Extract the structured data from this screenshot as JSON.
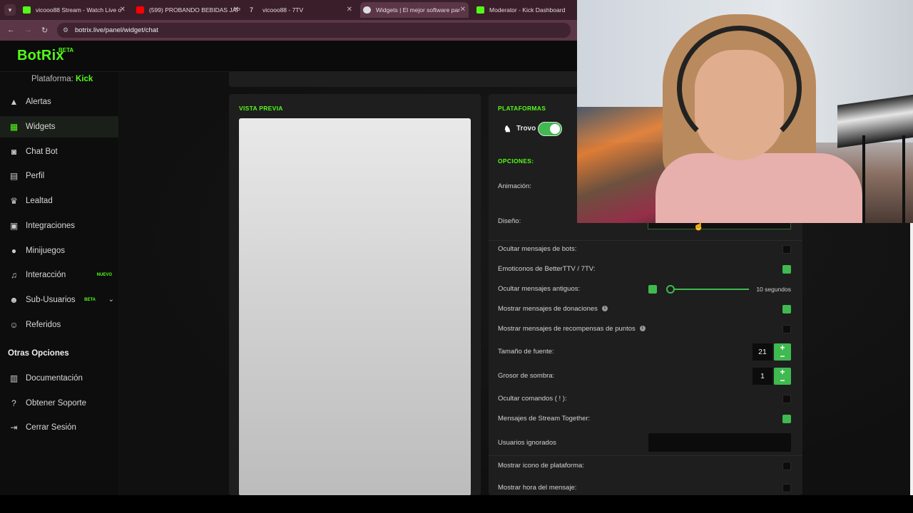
{
  "browser": {
    "tabs": [
      {
        "title": "vicooo88 Stream - Watch Live o",
        "color": "#53fc18"
      },
      {
        "title": "(599) PROBANDO BEBIDAS JAP",
        "color": "#ff0000"
      },
      {
        "title": "vicooo88 - 7TV",
        "color": "#ffffff"
      },
      {
        "title": "Widgets | El mejor software par",
        "color": "#ffffff"
      },
      {
        "title": "Moderator - Kick Dashboard",
        "color": "#53fc18"
      }
    ],
    "url": "botrix.live/panel/widget/chat"
  },
  "app": {
    "logo": "BotRix",
    "logo_badge": "BETA",
    "platform_label": "Plataforma:",
    "platform_value": "Kick",
    "accent": "#53fc18"
  },
  "sidebar": {
    "items": [
      {
        "label": "Alertas",
        "icon": "warning-icon"
      },
      {
        "label": "Widgets",
        "icon": "grid-icon",
        "active": true
      },
      {
        "label": "Chat Bot",
        "icon": "robot-icon"
      },
      {
        "label": "Perfil",
        "icon": "id-card-icon"
      },
      {
        "label": "Lealtad",
        "icon": "trophy-icon"
      },
      {
        "label": "Integraciones",
        "icon": "plug-icon"
      },
      {
        "label": "Minijuegos",
        "icon": "gamepad-icon"
      },
      {
        "label": "Interacción",
        "icon": "music-icon",
        "badge": "NUEVO"
      },
      {
        "label": "Sub-Usuarios",
        "icon": "users-icon",
        "badge": "BETA"
      },
      {
        "label": "Referidos",
        "icon": "user-group-icon"
      }
    ],
    "section_title": "Otras Opciones",
    "other_items": [
      {
        "label": "Documentación",
        "icon": "doc-icon"
      },
      {
        "label": "Obtener Soporte",
        "icon": "help-icon"
      },
      {
        "label": "Cerrar Sesión",
        "icon": "logout-icon"
      }
    ]
  },
  "preview": {
    "title": "VISTA PREVIA"
  },
  "platforms": {
    "title": "PLATAFORMAS",
    "trovo_label": "Trovo",
    "trovo_enabled": true
  },
  "options": {
    "title": "OPCIONES:",
    "animation_label": "Animación:",
    "design_label": "Diseño:",
    "rows": [
      {
        "label": "Ocultar mensajes de bots:",
        "checked": false
      },
      {
        "label": "Emoticonos de BetterTTV / 7TV:",
        "checked": true
      },
      {
        "label": "Ocultar mensajes antiguos:",
        "checked": true,
        "slider_value": "10 segundos"
      },
      {
        "label": "Mostrar mensajes de donaciones",
        "checked": true,
        "info": true
      },
      {
        "label": "Mostrar mensajes de recompensas de puntos",
        "checked": false,
        "info": true
      }
    ],
    "font_size_label": "Tamaño de fuente:",
    "font_size_value": "21",
    "shadow_label": "Grosor de sombra:",
    "shadow_value": "1",
    "rows2": [
      {
        "label": "Ocultar comandos ( ! ):",
        "checked": false
      },
      {
        "label": "Mensajes de Stream Together:",
        "checked": true
      }
    ],
    "ignored_users_label": "Usuarios ignorados",
    "rows3": [
      {
        "label": "Mostrar icono de plataforma:",
        "checked": false
      },
      {
        "label": "Mostrar hora del mensaje:",
        "checked": false
      }
    ]
  }
}
